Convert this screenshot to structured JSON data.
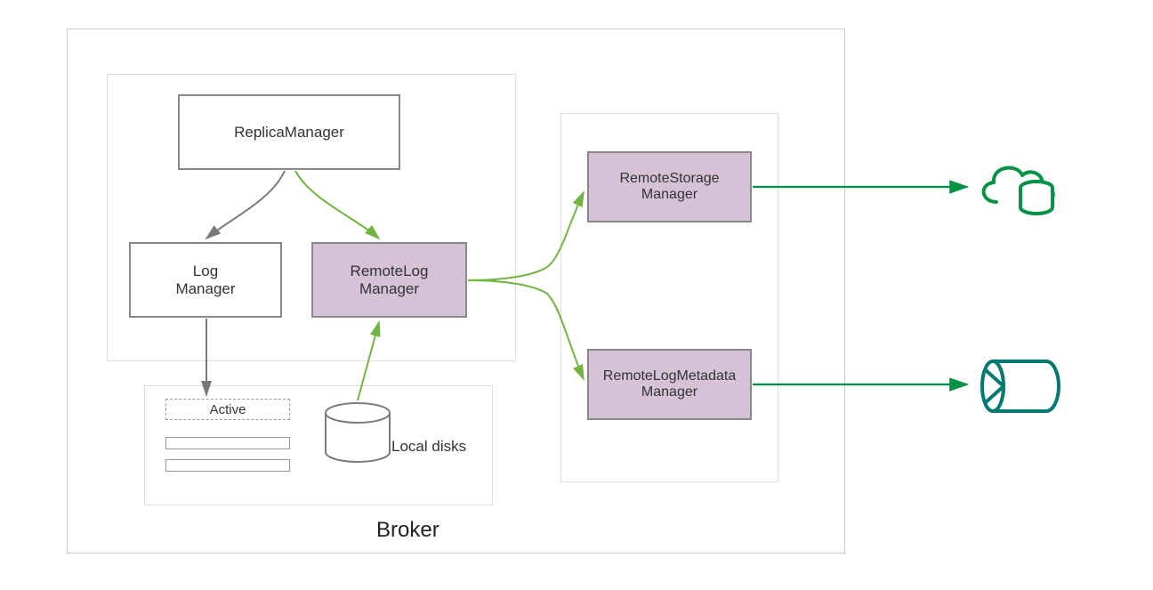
{
  "broker": {
    "title": "Broker",
    "replicaManager": "ReplicaManager",
    "logManager_l1": "Log",
    "logManager_l2": "Manager",
    "remoteLogManager_l1": "RemoteLog",
    "remoteLogManager_l2": "Manager",
    "active": "Active",
    "localDisks": "Local disks",
    "remoteStorage_l1": "RemoteStorage",
    "remoteStorage_l2": "Manager",
    "remoteLogMetadata_l1": "RemoteLogMetadata",
    "remoteLogMetadata_l2": "Manager"
  },
  "colors": {
    "grayStroke": "#7a7a7a",
    "greenArrow": "#72b443",
    "darkGreen": "#009245",
    "teal": "#007a70"
  }
}
